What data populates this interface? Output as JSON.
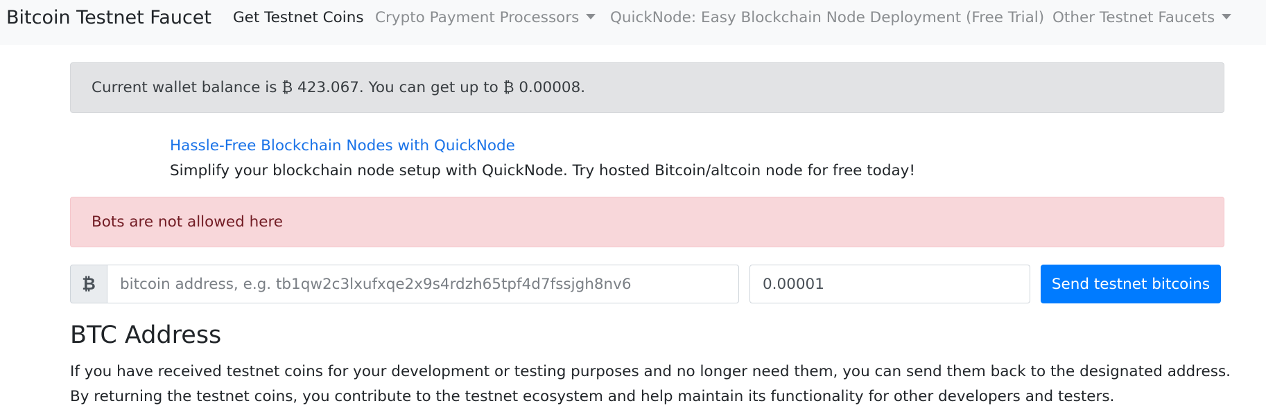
{
  "navbar": {
    "brand": "Bitcoin Testnet Faucet",
    "links": [
      {
        "label": "Get Testnet Coins",
        "active": true
      },
      {
        "label": "Crypto Payment Processors",
        "dropdown": true
      },
      {
        "label": "QuickNode: Easy Blockchain Node Deployment (Free Trial)"
      },
      {
        "label": "Other Testnet Faucets",
        "dropdown": true
      }
    ]
  },
  "balance_alert": {
    "text": "Current wallet balance is ₿ 423.067. You can get up to ₿ 0.00008."
  },
  "promo": {
    "link_text": "Hassle-Free Blockchain Nodes with QuickNode",
    "description": "Simplify your blockchain node setup with QuickNode. Try hosted Bitcoin/altcoin node for free today!"
  },
  "error_alert": {
    "text": "Bots are not allowed here"
  },
  "form": {
    "currency_symbol": "₿",
    "address_placeholder": "bitcoin address, e.g. tb1qw2c3lxufxqe2x9s4rdzh65tpf4d7fssjgh8nv6",
    "address_value": "",
    "amount_value": "0.00001",
    "submit_label": "Send testnet bitcoins"
  },
  "btc_address_section": {
    "title": "BTC Address",
    "lines": [
      "If you have received testnet coins for your development or testing purposes and no longer need them, you can send them back to the designated address.",
      "By returning the testnet coins, you contribute to the testnet ecosystem and help maintain its functionality for other developers and testers."
    ]
  },
  "colors": {
    "navbar_bg": "#f8f9fa",
    "primary": "#007bff",
    "link": "#1a73e8",
    "alert_secondary_bg": "#e2e3e5",
    "alert_danger_bg": "#f8d7da",
    "alert_danger_text": "#721c24"
  }
}
